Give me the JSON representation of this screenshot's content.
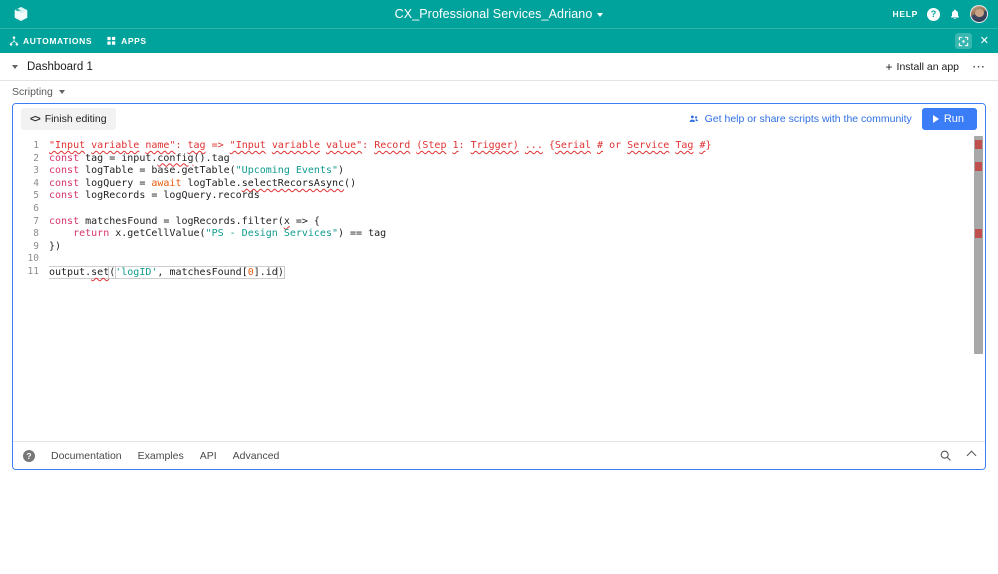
{
  "header": {
    "logo_icon": "cube-logo-icon",
    "app_title": "CX_Professional Services_Adriano",
    "title_caret_icon": "chevron-down-icon",
    "help_label": "HELP",
    "help_icon": "question-circle-icon",
    "notifications_icon": "bell-icon",
    "avatar_icon": "user-avatar",
    "accent_teal": "#00a39c"
  },
  "navbar": {
    "items": [
      {
        "label": "AUTOMATIONS",
        "icon": "automations-icon"
      },
      {
        "label": "APPS",
        "icon": "apps-icon"
      }
    ],
    "expand_icon": "expand-fullscreen-icon",
    "close_icon": "close-icon"
  },
  "dashboard_bar": {
    "caret_icon": "chevron-down-icon",
    "title": "Dashboard 1",
    "install_label": "Install an app",
    "plus_icon": "plus-icon",
    "more_icon": "ellipsis-icon"
  },
  "scripting": {
    "label": "Scripting",
    "caret_icon": "chevron-down-icon"
  },
  "panel": {
    "border_color": "#3b7df6",
    "toolbar": {
      "finish_label": "Finish editing",
      "finish_icon": "code-brackets-icon",
      "community_label": "Get help or share scripts with the community",
      "community_icon": "people-icon",
      "run_label": "Run",
      "run_icon": "play-icon",
      "run_color": "#3b7df6"
    },
    "editor": {
      "line_numbers": [
        "1",
        "2",
        "3",
        "4",
        "5",
        "6",
        "7",
        "8",
        "9",
        "10",
        "11"
      ],
      "lines": [
        "\"Input variable name\": tag => \"Input variable value\": Record (Step 1: Trigger) ... {Serial # or Service Tag #}",
        "const tag = input.config().tag",
        "const logTable = base.getTable(\"Upcoming Events\")",
        "const logQuery = await logTable.selectRecorsAsync()",
        "const logRecords = logQuery.records",
        "",
        "const matchesFound = logRecords.filter(x => {",
        "    return x.getCellValue(\"PS - Design Services\") == tag",
        "})",
        "",
        "output.set('logID', matchesFound[0].id)"
      ]
    },
    "footer": {
      "help_icon": "question-circle-icon",
      "links": [
        "Documentation",
        "Examples",
        "API",
        "Advanced"
      ],
      "search_icon": "search-icon",
      "collapse_icon": "chevron-up-icon"
    }
  }
}
